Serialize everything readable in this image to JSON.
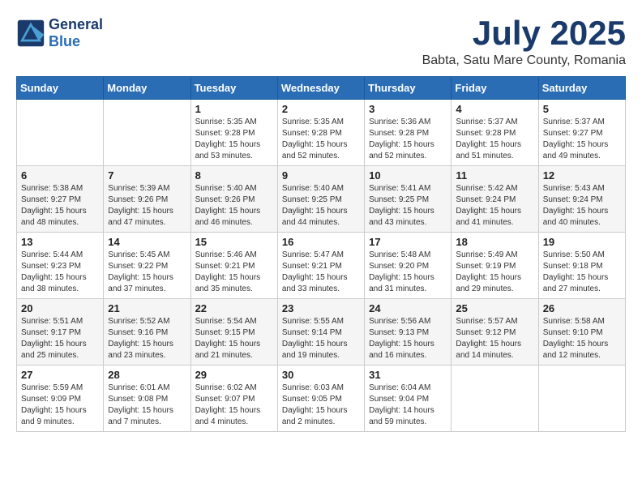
{
  "header": {
    "logo_line1": "General",
    "logo_line2": "Blue",
    "month_year": "July 2025",
    "location": "Babta, Satu Mare County, Romania"
  },
  "weekdays": [
    "Sunday",
    "Monday",
    "Tuesday",
    "Wednesday",
    "Thursday",
    "Friday",
    "Saturday"
  ],
  "weeks": [
    [
      {
        "day": "",
        "sunrise": "",
        "sunset": "",
        "daylight": ""
      },
      {
        "day": "",
        "sunrise": "",
        "sunset": "",
        "daylight": ""
      },
      {
        "day": "1",
        "sunrise": "Sunrise: 5:35 AM",
        "sunset": "Sunset: 9:28 PM",
        "daylight": "Daylight: 15 hours and 53 minutes."
      },
      {
        "day": "2",
        "sunrise": "Sunrise: 5:35 AM",
        "sunset": "Sunset: 9:28 PM",
        "daylight": "Daylight: 15 hours and 52 minutes."
      },
      {
        "day": "3",
        "sunrise": "Sunrise: 5:36 AM",
        "sunset": "Sunset: 9:28 PM",
        "daylight": "Daylight: 15 hours and 52 minutes."
      },
      {
        "day": "4",
        "sunrise": "Sunrise: 5:37 AM",
        "sunset": "Sunset: 9:28 PM",
        "daylight": "Daylight: 15 hours and 51 minutes."
      },
      {
        "day": "5",
        "sunrise": "Sunrise: 5:37 AM",
        "sunset": "Sunset: 9:27 PM",
        "daylight": "Daylight: 15 hours and 49 minutes."
      }
    ],
    [
      {
        "day": "6",
        "sunrise": "Sunrise: 5:38 AM",
        "sunset": "Sunset: 9:27 PM",
        "daylight": "Daylight: 15 hours and 48 minutes."
      },
      {
        "day": "7",
        "sunrise": "Sunrise: 5:39 AM",
        "sunset": "Sunset: 9:26 PM",
        "daylight": "Daylight: 15 hours and 47 minutes."
      },
      {
        "day": "8",
        "sunrise": "Sunrise: 5:40 AM",
        "sunset": "Sunset: 9:26 PM",
        "daylight": "Daylight: 15 hours and 46 minutes."
      },
      {
        "day": "9",
        "sunrise": "Sunrise: 5:40 AM",
        "sunset": "Sunset: 9:25 PM",
        "daylight": "Daylight: 15 hours and 44 minutes."
      },
      {
        "day": "10",
        "sunrise": "Sunrise: 5:41 AM",
        "sunset": "Sunset: 9:25 PM",
        "daylight": "Daylight: 15 hours and 43 minutes."
      },
      {
        "day": "11",
        "sunrise": "Sunrise: 5:42 AM",
        "sunset": "Sunset: 9:24 PM",
        "daylight": "Daylight: 15 hours and 41 minutes."
      },
      {
        "day": "12",
        "sunrise": "Sunrise: 5:43 AM",
        "sunset": "Sunset: 9:24 PM",
        "daylight": "Daylight: 15 hours and 40 minutes."
      }
    ],
    [
      {
        "day": "13",
        "sunrise": "Sunrise: 5:44 AM",
        "sunset": "Sunset: 9:23 PM",
        "daylight": "Daylight: 15 hours and 38 minutes."
      },
      {
        "day": "14",
        "sunrise": "Sunrise: 5:45 AM",
        "sunset": "Sunset: 9:22 PM",
        "daylight": "Daylight: 15 hours and 37 minutes."
      },
      {
        "day": "15",
        "sunrise": "Sunrise: 5:46 AM",
        "sunset": "Sunset: 9:21 PM",
        "daylight": "Daylight: 15 hours and 35 minutes."
      },
      {
        "day": "16",
        "sunrise": "Sunrise: 5:47 AM",
        "sunset": "Sunset: 9:21 PM",
        "daylight": "Daylight: 15 hours and 33 minutes."
      },
      {
        "day": "17",
        "sunrise": "Sunrise: 5:48 AM",
        "sunset": "Sunset: 9:20 PM",
        "daylight": "Daylight: 15 hours and 31 minutes."
      },
      {
        "day": "18",
        "sunrise": "Sunrise: 5:49 AM",
        "sunset": "Sunset: 9:19 PM",
        "daylight": "Daylight: 15 hours and 29 minutes."
      },
      {
        "day": "19",
        "sunrise": "Sunrise: 5:50 AM",
        "sunset": "Sunset: 9:18 PM",
        "daylight": "Daylight: 15 hours and 27 minutes."
      }
    ],
    [
      {
        "day": "20",
        "sunrise": "Sunrise: 5:51 AM",
        "sunset": "Sunset: 9:17 PM",
        "daylight": "Daylight: 15 hours and 25 minutes."
      },
      {
        "day": "21",
        "sunrise": "Sunrise: 5:52 AM",
        "sunset": "Sunset: 9:16 PM",
        "daylight": "Daylight: 15 hours and 23 minutes."
      },
      {
        "day": "22",
        "sunrise": "Sunrise: 5:54 AM",
        "sunset": "Sunset: 9:15 PM",
        "daylight": "Daylight: 15 hours and 21 minutes."
      },
      {
        "day": "23",
        "sunrise": "Sunrise: 5:55 AM",
        "sunset": "Sunset: 9:14 PM",
        "daylight": "Daylight: 15 hours and 19 minutes."
      },
      {
        "day": "24",
        "sunrise": "Sunrise: 5:56 AM",
        "sunset": "Sunset: 9:13 PM",
        "daylight": "Daylight: 15 hours and 16 minutes."
      },
      {
        "day": "25",
        "sunrise": "Sunrise: 5:57 AM",
        "sunset": "Sunset: 9:12 PM",
        "daylight": "Daylight: 15 hours and 14 minutes."
      },
      {
        "day": "26",
        "sunrise": "Sunrise: 5:58 AM",
        "sunset": "Sunset: 9:10 PM",
        "daylight": "Daylight: 15 hours and 12 minutes."
      }
    ],
    [
      {
        "day": "27",
        "sunrise": "Sunrise: 5:59 AM",
        "sunset": "Sunset: 9:09 PM",
        "daylight": "Daylight: 15 hours and 9 minutes."
      },
      {
        "day": "28",
        "sunrise": "Sunrise: 6:01 AM",
        "sunset": "Sunset: 9:08 PM",
        "daylight": "Daylight: 15 hours and 7 minutes."
      },
      {
        "day": "29",
        "sunrise": "Sunrise: 6:02 AM",
        "sunset": "Sunset: 9:07 PM",
        "daylight": "Daylight: 15 hours and 4 minutes."
      },
      {
        "day": "30",
        "sunrise": "Sunrise: 6:03 AM",
        "sunset": "Sunset: 9:05 PM",
        "daylight": "Daylight: 15 hours and 2 minutes."
      },
      {
        "day": "31",
        "sunrise": "Sunrise: 6:04 AM",
        "sunset": "Sunset: 9:04 PM",
        "daylight": "Daylight: 14 hours and 59 minutes."
      },
      {
        "day": "",
        "sunrise": "",
        "sunset": "",
        "daylight": ""
      },
      {
        "day": "",
        "sunrise": "",
        "sunset": "",
        "daylight": ""
      }
    ]
  ]
}
